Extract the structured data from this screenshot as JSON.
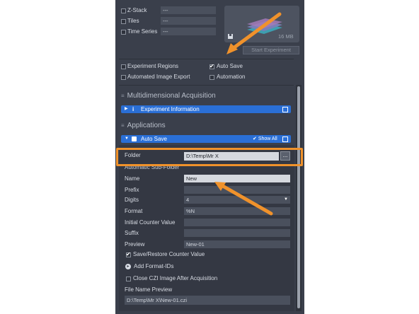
{
  "dimensions": [
    {
      "label": "Z-Stack",
      "value": "---",
      "checked": false
    },
    {
      "label": "Tiles",
      "value": "---",
      "checked": false
    },
    {
      "label": "Time Series",
      "value": "---",
      "checked": false
    }
  ],
  "preview": {
    "size": "16 MB",
    "start_button": "Start Experiment"
  },
  "options": {
    "experiment_regions": "Experiment Regions",
    "auto_save": "Auto Save",
    "automated_image_export": "Automated Image Export",
    "automation": "Automation"
  },
  "sections": {
    "multidimensional": "Multidimensional Acquisition",
    "experiment_information": "Experiment Information",
    "applications": "Applications",
    "auto_save": "Auto Save",
    "show_all": "Show All"
  },
  "form": {
    "folder_label": "Folder",
    "folder_value": "D:\\Temp\\Mr X",
    "browse": "...",
    "auto_subfolder": "Automatic Sub-Folder",
    "name_label": "Name",
    "name_value": "New",
    "prefix_label": "Prefix",
    "prefix_value": "",
    "digits_label": "Digits",
    "digits_value": "4",
    "format_label": "Format",
    "format_value": "%N",
    "initial_counter_label": "Initial Counter Value",
    "initial_counter_value": "",
    "suffix_label": "Suffix",
    "suffix_value": "",
    "preview_label": "Preview",
    "preview_value": "New-01",
    "save_restore": "Save/Restore Counter Value",
    "add_format_ids": "Add Format-IDs",
    "close_czi": "Close CZI Image After Acquisition",
    "file_name_preview_label": "File Name Preview",
    "file_name_preview_value": "D:\\Temp\\Mr X\\New-01.czi"
  },
  "annotation_color": "#f0922b"
}
